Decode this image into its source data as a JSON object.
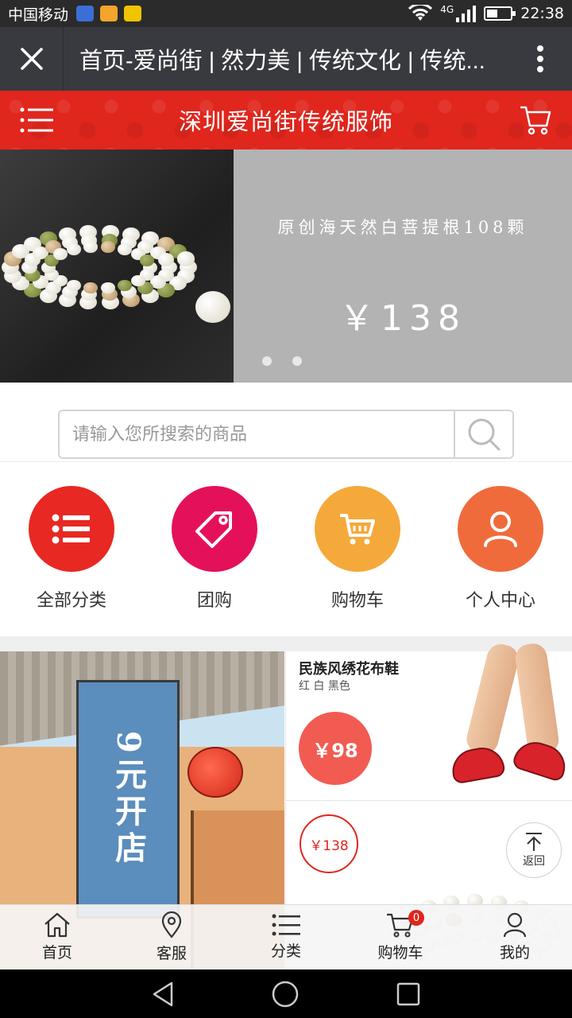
{
  "status_bar": {
    "carrier": "中国移动",
    "network": "4G",
    "time": "22:38",
    "battery_level": 0.45
  },
  "webview": {
    "title": "首页-爱尚街 | 然力美 | 传统文化 | 传统..."
  },
  "header": {
    "shop_name": "深圳爱尚街传统服饰"
  },
  "banner": {
    "caption": "原创海天然白菩提根108颗",
    "price": "￥138",
    "slide_count": 2
  },
  "search": {
    "placeholder": "请输入您所搜索的商品"
  },
  "quick_nav": [
    {
      "label": "全部分类",
      "color": "#e82822",
      "icon": "list-icon"
    },
    {
      "label": "团购",
      "color": "#e5105a",
      "icon": "tag-icon"
    },
    {
      "label": "购物车",
      "color": "#f5a93a",
      "icon": "cart-icon"
    },
    {
      "label": "个人中心",
      "color": "#ef6b3c",
      "icon": "user-icon"
    }
  ],
  "promo": {
    "left_banner_text": "9元开店",
    "item1": {
      "title": "民族风绣花布鞋",
      "subtitle": "红 白 黑色",
      "price": "￥98"
    },
    "item2": {
      "price": "￥138"
    }
  },
  "back_to_top": "返回",
  "tabs": [
    {
      "label": "首页",
      "icon": "home-icon"
    },
    {
      "label": "客服",
      "icon": "location-pin-icon"
    },
    {
      "label": "分类",
      "icon": "list-icon"
    },
    {
      "label": "购物车",
      "icon": "cart-icon",
      "badge": "0"
    },
    {
      "label": "我的",
      "icon": "user-icon"
    }
  ],
  "colors": {
    "brand_red": "#e0261d",
    "title_bar": "#393a3f"
  }
}
